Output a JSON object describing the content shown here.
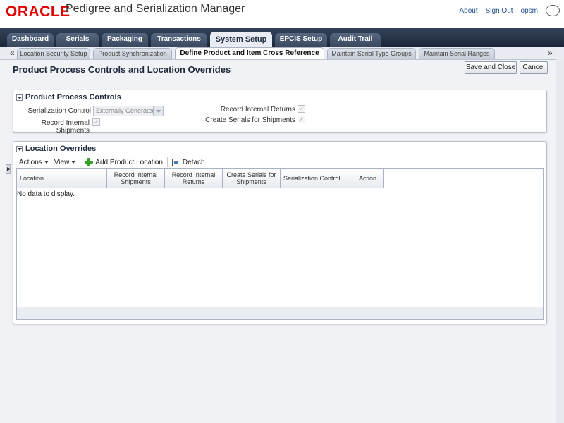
{
  "header": {
    "logo": "ORACLE",
    "app_title": "Pedigree and Serialization Manager",
    "links": {
      "about": "About",
      "sign_out": "Sign Out",
      "opsm": "opsm"
    }
  },
  "main_tabs": [
    {
      "label": "Dashboard"
    },
    {
      "label": "Serials"
    },
    {
      "label": "Packaging"
    },
    {
      "label": "Transactions"
    },
    {
      "label": "System Setup",
      "active": true
    },
    {
      "label": "EPCIS Setup"
    },
    {
      "label": "Audit Trail"
    }
  ],
  "sub_tabs": [
    {
      "label": "Location Security Setup"
    },
    {
      "label": "Product Synchronization"
    },
    {
      "label": "Define Product and Item Cross Reference",
      "active": true
    },
    {
      "label": "Maintain Serial Type Groups"
    },
    {
      "label": "Maintain Serial Ranges"
    }
  ],
  "scroll": {
    "left": "«",
    "right": "»"
  },
  "page": {
    "title": "Product Process Controls and Location Overrides",
    "save_close": "Save and Close",
    "cancel": "Cancel"
  },
  "product_controls": {
    "title": "Product Process Controls",
    "serialization_control_label": "Serialization Control",
    "serialization_control_value": "Externally Generated",
    "record_internal_shipments_label": "Record Internal Shipments",
    "record_internal_returns_label": "Record Internal Returns",
    "create_serials_label": "Create Serials for Shipments",
    "check_mark": "✓"
  },
  "location_overrides": {
    "title": "Location Overrides",
    "actions": "Actions",
    "view": "View",
    "add_product_location": "Add Product Location",
    "detach": "Detach",
    "columns": [
      "Location",
      "Record Internal Shipments",
      "Record Internal Returns",
      "Create Serials for Shipments",
      "Serialization Control",
      "Action"
    ],
    "no_data": "No data to display."
  },
  "colors": {
    "brand_red": "#e00000",
    "tab_bar": "#1c2739",
    "link_blue": "#1e4b8c"
  }
}
